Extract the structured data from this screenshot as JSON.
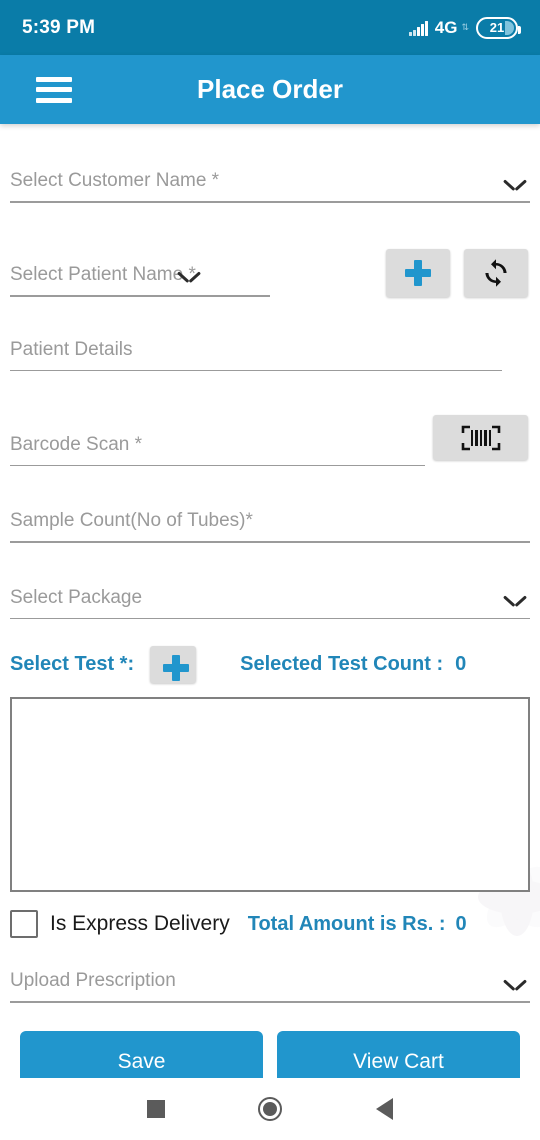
{
  "status_bar": {
    "time": "5:39 PM",
    "network": "4G",
    "battery_level": "21",
    "signal_icon": "signal-bars-icon",
    "battery_icon": "battery-icon"
  },
  "app_bar": {
    "title": "Place Order",
    "menu_icon": "hamburger-menu-icon",
    "background_color": "#2196cd"
  },
  "form": {
    "customer": {
      "label": "Select Customer Name *",
      "value": ""
    },
    "patient": {
      "label": "Select Patient Name *",
      "value": "",
      "add_icon": "plus-icon",
      "refresh_icon": "refresh-sync-icon"
    },
    "patient_details": {
      "label": "Patient Details",
      "value": ""
    },
    "barcode": {
      "label": "Barcode Scan *",
      "value": "",
      "scan_icon": "barcode-scan-icon"
    },
    "sample_count": {
      "label": "Sample Count(No of Tubes)*",
      "value": ""
    },
    "package": {
      "label": "Select Package",
      "value": ""
    },
    "select_test": {
      "label": "Select Test *:",
      "add_icon": "plus-icon",
      "count_label": "Selected Test Count :",
      "count_value": "0"
    },
    "express_delivery": {
      "label": "Is Express Delivery",
      "checked": false
    },
    "total_amount": {
      "label": "Total Amount is Rs. :",
      "value": "0"
    },
    "upload_prescription": {
      "label": "Upload Prescription",
      "value": ""
    }
  },
  "actions": {
    "save_label": "Save",
    "view_cart_label": "View Cart"
  },
  "nav_bar": {
    "recents_icon": "square-recents-icon",
    "home_icon": "circle-home-icon",
    "back_icon": "triangle-back-icon"
  },
  "colors": {
    "status_bar": "#0a7ca8",
    "app_bar": "#2196cd",
    "accent": "#2186b8",
    "button": "#2196cd"
  }
}
